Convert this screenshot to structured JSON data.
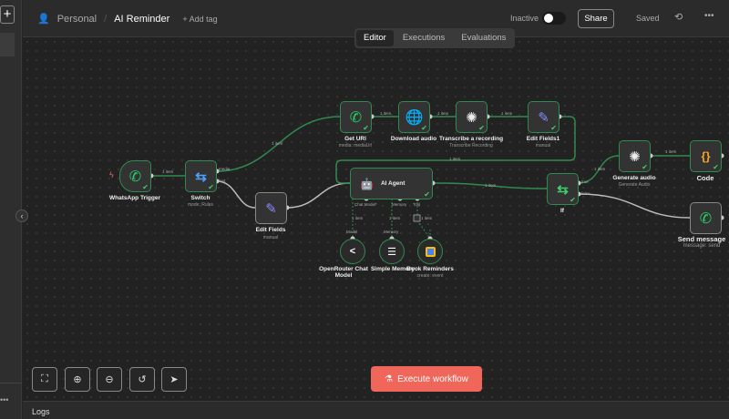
{
  "header": {
    "project": "Personal",
    "workflow_name": "AI Reminder",
    "add_tag": "+ Add tag",
    "status": "Inactive",
    "share": "Share",
    "saved": "Saved"
  },
  "tabs": [
    "Editor",
    "Executions",
    "Evaluations"
  ],
  "nodes": {
    "trigger": {
      "label": "WhatsApp Trigger"
    },
    "switch": {
      "label": "Switch",
      "sub": "mode: Rules",
      "out1": "media",
      "out2": "text"
    },
    "edit_fields": {
      "label": "Edit Fields",
      "sub": "manual"
    },
    "get_url": {
      "label": "Get URl",
      "sub": "media: mediaUrl"
    },
    "download": {
      "label": "Download audio"
    },
    "transcribe": {
      "label": "Transcribe a recording",
      "sub": "Transcribe Recording"
    },
    "edit_fields1": {
      "label": "Edit Fields1",
      "sub": "manual"
    },
    "agent": {
      "label": "AI Agent",
      "in1": "Chat Model*",
      "in2": "Memory",
      "in3": "Tool"
    },
    "if": {
      "label": "If",
      "out1": "true",
      "out2": "false"
    },
    "generate": {
      "label": "Generate audio",
      "sub": "Generate Audio"
    },
    "code": {
      "label": "Code"
    },
    "send": {
      "label": "Send message",
      "sub": "message: send"
    },
    "model": {
      "label": "OpenRouter Chat Model",
      "top": "Model"
    },
    "memory": {
      "label": "Simple Memory",
      "top": "Memory"
    },
    "calendar": {
      "label": "Book Reminders",
      "sub": "create: event"
    }
  },
  "edge_label": "1 item",
  "controls": {
    "execute": "Execute workflow"
  },
  "logs": "Logs",
  "colors": {
    "success": "#2f8a4f",
    "execute": "#f0665a"
  }
}
